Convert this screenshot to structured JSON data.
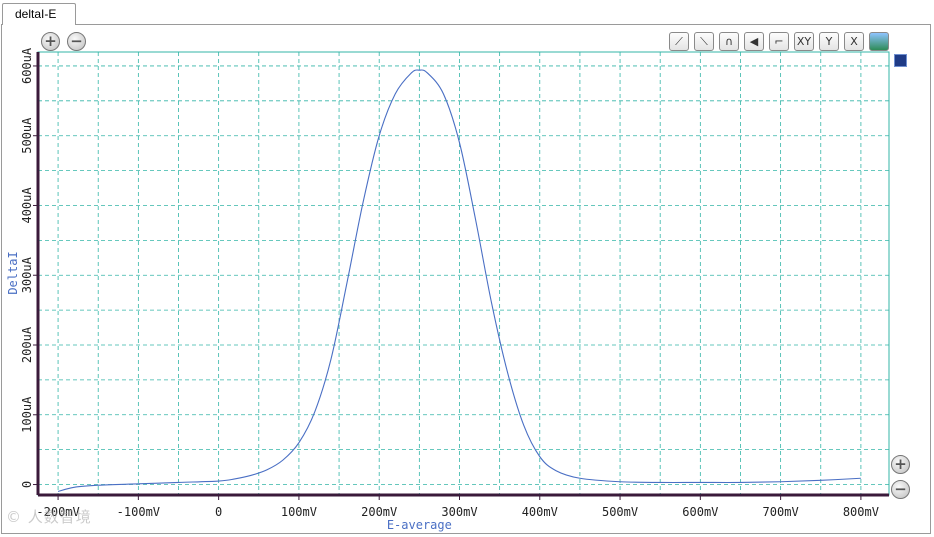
{
  "tab": {
    "label": "deltaI-E"
  },
  "toolbar": {
    "buttons": [
      {
        "icon": "line-up-icon",
        "glyph": "⟋"
      },
      {
        "icon": "line-down-icon",
        "glyph": "⟍"
      },
      {
        "icon": "peak-icon",
        "glyph": "∩"
      },
      {
        "icon": "triangle-icon",
        "glyph": "◀"
      },
      {
        "icon": "step-icon",
        "glyph": "⌐"
      },
      {
        "icon": "axis-xy-icon",
        "glyph": "XY"
      },
      {
        "icon": "axis-y-icon",
        "glyph": "Y"
      },
      {
        "icon": "axis-x-icon",
        "glyph": "X"
      },
      {
        "icon": "image-icon",
        "glyph": "▬"
      }
    ],
    "zoom_in_glyph": "+",
    "zoom_out_glyph": "−"
  },
  "watermark": {
    "text": "© 人数智境"
  },
  "colors": {
    "curve": "#4a6fc4",
    "grid": "#33b5a7",
    "axis": "#3a1a3a",
    "legend": "#1f3b86"
  },
  "chart_data": {
    "type": "line",
    "xlabel": "E-average",
    "ylabel": "DeltaI",
    "xlim": [
      -225,
      835
    ],
    "ylim": [
      -15,
      620
    ],
    "x_ticks": [
      -200,
      -100,
      0,
      100,
      200,
      300,
      400,
      500,
      600,
      700,
      800
    ],
    "x_tick_labels": [
      "-200mV",
      "-100mV",
      "0",
      "100mV",
      "200mV",
      "300mV",
      "400mV",
      "500mV",
      "600mV",
      "700mV",
      "800mV"
    ],
    "y_ticks": [
      0,
      100,
      200,
      300,
      400,
      500,
      600
    ],
    "y_tick_labels": [
      "0",
      "100uA",
      "200uA",
      "300uA",
      "400uA",
      "500uA",
      "600uA"
    ],
    "grid": true,
    "series": [
      {
        "x": [
          -200,
          -180,
          -150,
          -100,
          -50,
          0,
          20,
          40,
          60,
          80,
          100,
          120,
          140,
          160,
          180,
          200,
          220,
          240,
          250,
          260,
          280,
          300,
          320,
          340,
          360,
          380,
          400,
          420,
          450,
          500,
          550,
          600,
          650,
          700,
          750,
          800
        ],
        "y": [
          -10,
          -4,
          -1,
          1,
          3,
          5,
          8,
          13,
          21,
          35,
          60,
          105,
          180,
          290,
          405,
          500,
          560,
          590,
          594,
          590,
          560,
          490,
          380,
          260,
          160,
          85,
          40,
          20,
          9,
          4,
          3,
          3,
          3,
          4,
          6,
          9
        ]
      }
    ]
  }
}
